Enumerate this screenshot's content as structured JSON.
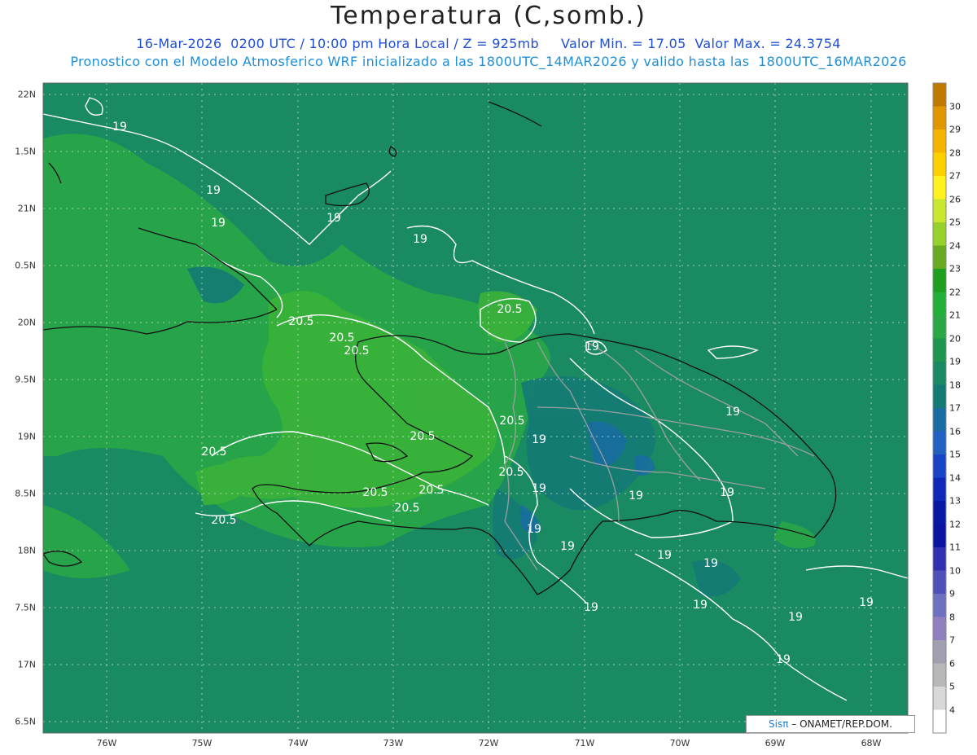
{
  "header": {
    "title": "Temperatura (C,somb.)",
    "subtitle_date": "16-Mar-2026  0200 UTC / 10:00 pm Hora Local / Z = 925mb",
    "valor_min": "Valor Min. = 17.05",
    "valor_max": "Valor Max. = 24.3754",
    "subtitle_model": "Pronostico con el Modelo Atmosferico WRF inicializado a las 1800UTC_14MAR2026 y valido hasta las  1800UTC_16MAR2026"
  },
  "axes": {
    "lat_labels": [
      "22N",
      "1.5N",
      "21N",
      "0.5N",
      "20N",
      "9.5N",
      "19N",
      "8.5N",
      "18N",
      "7.5N",
      "17N",
      "6.5N"
    ],
    "lon_labels": [
      "76W",
      "75W",
      "74W",
      "73W",
      "72W",
      "71W",
      "70W",
      "69W",
      "68W"
    ]
  },
  "contour_labels": [
    "19",
    "19",
    "19",
    "19",
    "19",
    "20.5",
    "20.5",
    "20.5",
    "20.5",
    "20.5",
    "20.5",
    "20.5",
    "20.5",
    "20.5",
    "20.5",
    "20.5",
    "20.5",
    "19",
    "19",
    "19",
    "19",
    "19",
    "19",
    "19",
    "19",
    "19",
    "19",
    "19",
    "19",
    "19",
    "19",
    "19"
  ],
  "colorbar": {
    "labels": [
      "30",
      "29",
      "28",
      "27",
      "26",
      "25",
      "24",
      "23",
      "22",
      "21",
      "20",
      "19",
      "18",
      "17",
      "16",
      "15",
      "14",
      "13",
      "12",
      "11",
      "10",
      "9",
      "8",
      "7",
      "6",
      "5",
      "4"
    ],
    "colors": [
      "#c07a00",
      "#e09600",
      "#f4b400",
      "#ffd000",
      "#fff020",
      "#c8e830",
      "#96d22a",
      "#6aaa20",
      "#1ea01e",
      "#22b03a",
      "#2aa846",
      "#1f9650",
      "#1a8a62",
      "#147a74",
      "#196ca2",
      "#2260c2",
      "#1a44c8",
      "#1028b8",
      "#0a18a6",
      "#0a14a0",
      "#3030b0",
      "#5050b8",
      "#7070c0",
      "#9080c0",
      "#a0a0b0",
      "#b8b8b8",
      "#d8d8d8",
      "#ffffff"
    ]
  },
  "credit": {
    "sis": "Sisπ",
    "rest": " – ONAMET/REP.DOM."
  }
}
